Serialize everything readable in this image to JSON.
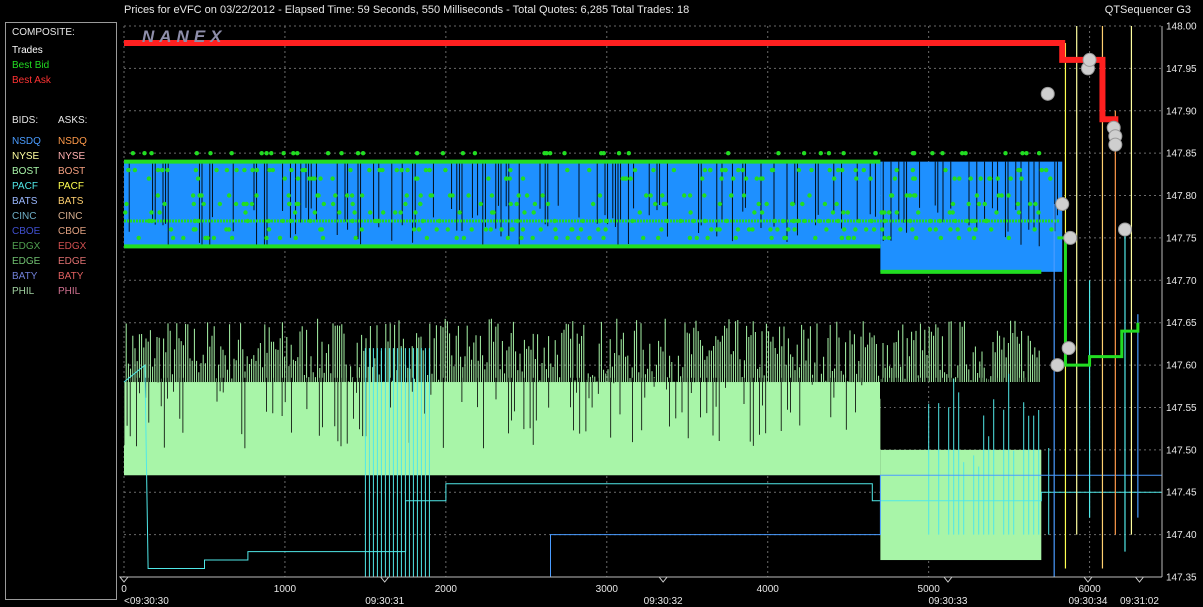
{
  "header": {
    "title": "Prices for  eVFC  on  03/22/2012  -  Elapsed Time: 59 Seconds, 550 Milliseconds  -  Total Quotes: 6,285  Total Trades: 18",
    "app_name": "QTSequencer G3"
  },
  "logo_text": "NANEX",
  "legend": {
    "composite_label": "COMPOSITE:",
    "composite_items": [
      {
        "label": "Trades",
        "color": "#ffffff"
      },
      {
        "label": "Best Bid",
        "color": "#22dd22"
      },
      {
        "label": "Best Ask",
        "color": "#ff3333"
      }
    ],
    "bids_label": "BIDS:",
    "asks_label": "ASKS:",
    "exchanges": [
      {
        "bid": "NSDQ",
        "bid_color": "#4a9cff",
        "ask": "NSDQ",
        "ask_color": "#ff9a4a"
      },
      {
        "bid": "NYSE",
        "bid_color": "#ffffa0",
        "ask": "NYSE",
        "ask_color": "#ffb0b0"
      },
      {
        "bid": "BOST",
        "bid_color": "#a8f5a8",
        "ask": "BOST",
        "ask_color": "#f5a080"
      },
      {
        "bid": "PACF",
        "bid_color": "#50e8e8",
        "ask": "PACF",
        "ask_color": "#ffff50"
      },
      {
        "bid": "BATS",
        "bid_color": "#9ab8ff",
        "ask": "BATS",
        "ask_color": "#ffd070"
      },
      {
        "bid": "CINC",
        "bid_color": "#70b0c8",
        "ask": "CINC",
        "ask_color": "#d8b090"
      },
      {
        "bid": "CBOE",
        "bid_color": "#4050d0",
        "ask": "CBOE",
        "ask_color": "#e0a080"
      },
      {
        "bid": "EDGX",
        "bid_color": "#50a050",
        "ask": "EDGX",
        "ask_color": "#d05050"
      },
      {
        "bid": "EDGE",
        "bid_color": "#70c070",
        "ask": "EDGE",
        "ask_color": "#e07070"
      },
      {
        "bid": "BATY",
        "bid_color": "#7080d8",
        "ask": "BATY",
        "ask_color": "#e06060"
      },
      {
        "bid": "PHIL",
        "bid_color": "#a0d0a0",
        "ask": "PHIL",
        "ask_color": "#d07090"
      }
    ]
  },
  "chart_data": {
    "type": "line",
    "xlim": [
      0,
      6450
    ],
    "ylim": [
      147.35,
      148.0
    ],
    "x_ticks": [
      0,
      1000,
      2000,
      3000,
      4000,
      5000,
      6000
    ],
    "y_ticks": [
      "147.35",
      "147.40",
      "147.45",
      "147.50",
      "147.55",
      "147.60",
      "147.65",
      "147.70",
      "147.75",
      "147.80",
      "147.85",
      "147.90",
      "147.95",
      "148.00"
    ],
    "time_labels": [
      {
        "x": 0,
        "label": "<09:30:30"
      },
      {
        "x": 1620,
        "label": "09:30:31"
      },
      {
        "x": 3350,
        "label": "09:30:32"
      },
      {
        "x": 5120,
        "label": "09:30:33"
      },
      {
        "x": 5990,
        "label": "09:30:34"
      },
      {
        "x": 6310,
        "label": "09:31:02"
      }
    ],
    "grid": true,
    "series": [
      {
        "name": "Best Ask",
        "color": "#ff2020",
        "points": [
          [
            0,
            147.98
          ],
          [
            5790,
            147.98
          ],
          [
            5830,
            147.96
          ],
          [
            5950,
            147.96
          ],
          [
            6080,
            147.89
          ],
          [
            6160,
            147.88
          ]
        ]
      },
      {
        "name": "Best Bid",
        "color": "#22dd22",
        "points": [
          [
            0,
            147.77
          ],
          [
            1400,
            147.76
          ],
          [
            3000,
            147.77
          ],
          [
            4700,
            147.76
          ],
          [
            5800,
            147.75
          ],
          [
            5850,
            147.6
          ],
          [
            6000,
            147.61
          ],
          [
            6200,
            147.64
          ],
          [
            6300,
            147.65
          ]
        ]
      },
      {
        "name": "NSDQ",
        "color": "#1e90ff",
        "band": [
          147.74,
          147.84
        ],
        "band_until": 5830,
        "late_band": [
          147.71,
          147.84
        ],
        "late_from": 4700
      },
      {
        "name": "BOST",
        "color": "#a8f5a8",
        "band": [
          147.47,
          147.58
        ],
        "band_until": 4700,
        "late_band": [
          147.37,
          147.5
        ],
        "late_from": 4700,
        "late_until": 5700
      }
    ],
    "trades": [
      {
        "x": 5740,
        "y": 147.92
      },
      {
        "x": 5830,
        "y": 147.79
      },
      {
        "x": 5870,
        "y": 147.62
      },
      {
        "x": 5800,
        "y": 147.6
      },
      {
        "x": 5990,
        "y": 147.95
      },
      {
        "x": 6000,
        "y": 147.96
      },
      {
        "x": 5880,
        "y": 147.75
      },
      {
        "x": 6150,
        "y": 147.88
      },
      {
        "x": 6160,
        "y": 147.87
      },
      {
        "x": 6160,
        "y": 147.86
      },
      {
        "x": 6220,
        "y": 147.76
      }
    ]
  }
}
